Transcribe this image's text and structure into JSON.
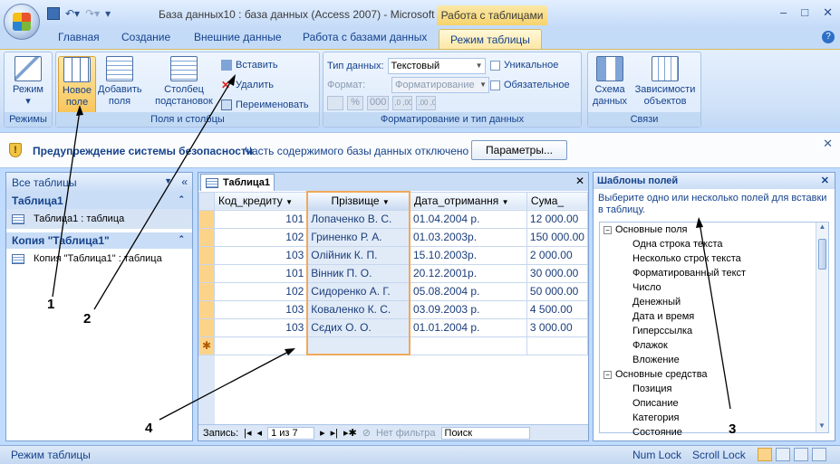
{
  "window": {
    "title": "База данных10 : база данных (Access 2007) - Microsoft ...",
    "context_title": "Работа с таблицами",
    "min": "–",
    "max": "□",
    "close": "✕"
  },
  "tabs": [
    "Главная",
    "Создание",
    "Внешние данные",
    "Работа с базами данных",
    "Режим таблицы"
  ],
  "ribbon": {
    "view": {
      "label": "Режим",
      "group": "Режимы"
    },
    "fields": {
      "new_field": "Новое поле",
      "add_fields": "Добавить поля",
      "lookup": "Столбец подстановок",
      "insert": "Вставить",
      "delete": "Удалить",
      "rename": "Переименовать",
      "group": "Поля и столбцы"
    },
    "format": {
      "type_label": "Тип данных:",
      "type_value": "Текстовый",
      "fmt_label": "Формат:",
      "fmt_value": "Форматирование",
      "unique": "Уникальное",
      "required": "Обязательное",
      "pct": "%",
      "thousands": "000",
      "inc_dec": ",0 ,00",
      "dec_dec": ",00 ,0",
      "group": "Форматирование и тип данных"
    },
    "rel": {
      "schema": "Схема данных",
      "deps": "Зависимости объектов",
      "group": "Связи"
    }
  },
  "security": {
    "title": "Предупреждение системы безопасности",
    "text": "Часть содержимого базы данных отключено",
    "button": "Параметры..."
  },
  "nav": {
    "header": "Все таблицы",
    "groups": [
      {
        "name": "Таблица1",
        "items": [
          "Таблица1 : таблица"
        ]
      },
      {
        "name": "Копия \"Таблица1\"",
        "items": [
          "Копия \"Таблица1\" : таблица"
        ]
      }
    ]
  },
  "datasheet": {
    "tab": "Таблица1",
    "columns": [
      "Код_кредиту",
      "Прізвище",
      "Дата_отримання",
      "Сума_"
    ],
    "rows": [
      [
        "101",
        "Лопаченко В. С.",
        "01.04.2004 р.",
        "12 000.00"
      ],
      [
        "102",
        "Гриненко Р. А.",
        "01.03.2003р.",
        "150 000.00"
      ],
      [
        "103",
        "Олійник К. П.",
        "15.10.2003р.",
        "2 000.00"
      ],
      [
        "101",
        "Вінник П. О.",
        "20.12.2001р.",
        "30 000.00"
      ],
      [
        "102",
        "Сидоренко А. Г.",
        "05.08.2004 р.",
        "50 000.00"
      ],
      [
        "103",
        "Коваленко К. С.",
        "03.09.2003 р.",
        "4 500.00"
      ],
      [
        "103",
        "Сєдих О. О.",
        "01.01.2004 р.",
        "3 000.00"
      ]
    ],
    "new_row_marker": "✱",
    "record_label": "Запись:",
    "record_pos": "1 из 7",
    "filter": "Нет фильтра",
    "search": "Поиск"
  },
  "templates": {
    "header": "Шаблоны полей",
    "description": "Выберите одно или несколько полей для вставки в таблицу.",
    "groups": [
      {
        "name": "Основные поля",
        "items": [
          "Одна строка текста",
          "Несколько строк текста",
          "Форматированный текст",
          "Число",
          "Денежный",
          "Дата и время",
          "Гиперссылка",
          "Флажок",
          "Вложение"
        ]
      },
      {
        "name": "Основные средства",
        "items": [
          "Позиция",
          "Описание",
          "Категория",
          "Состояние"
        ]
      }
    ]
  },
  "status": {
    "mode": "Режим таблицы",
    "numlock": "Num Lock",
    "scrolllock": "Scroll Lock"
  },
  "callouts": [
    "1",
    "2",
    "3",
    "4"
  ]
}
